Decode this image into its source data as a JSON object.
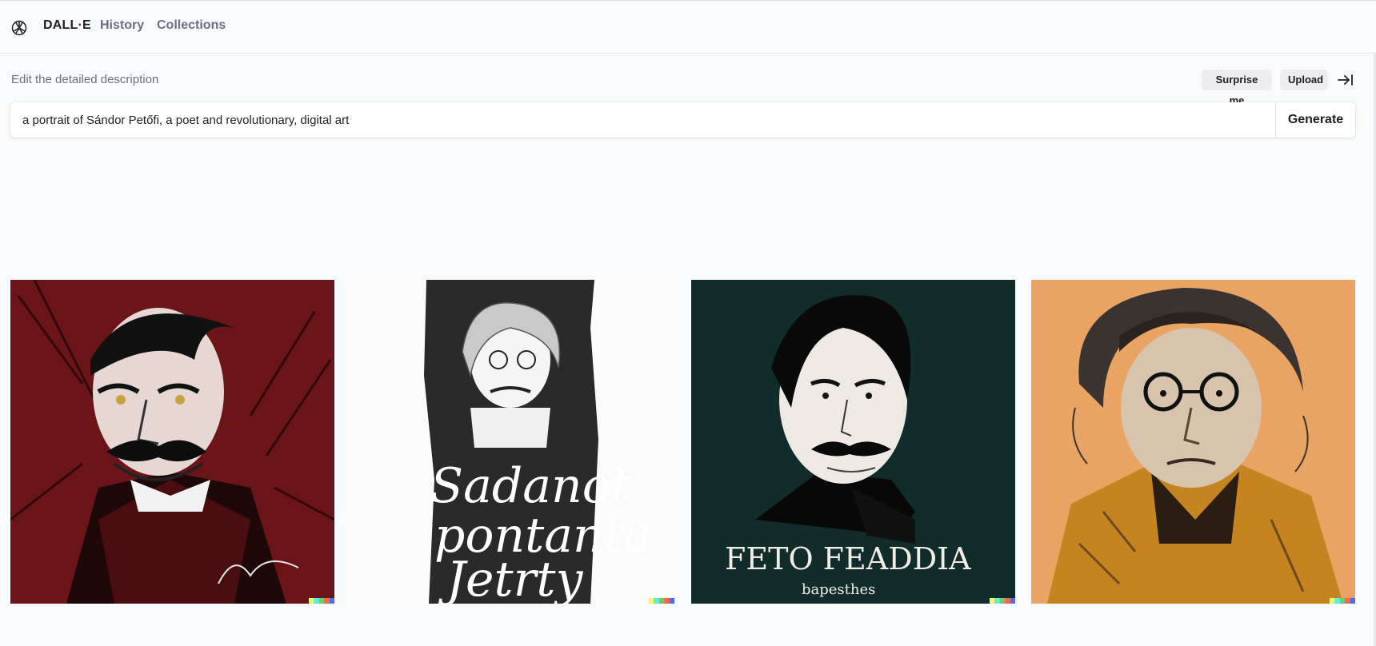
{
  "header": {
    "brand": "DALL·E",
    "nav": {
      "history": "History",
      "collections": "Collections"
    },
    "logo_icon": "openai-logo-icon"
  },
  "editor": {
    "label": "Edit the detailed description",
    "surprise_label": "Surprise me",
    "upload_label": "Upload",
    "collapse_icon": "arrow-right-to-bar-icon",
    "prompt_value": "a portrait of Sándor Petőfi, a poet and revolutionary, digital art",
    "generate_label": "Generate"
  },
  "results": {
    "images": [
      {
        "style": "red expressive ink portrait",
        "bg": "#6b1518"
      },
      {
        "style": "black and white banner with handwritten lettering",
        "bg": "#2a2a2a",
        "lettering": [
          "Sadanot",
          "pontanta",
          "Jetrty"
        ]
      },
      {
        "style": "dark green poster portrait",
        "bg": "#102d2b",
        "lettering": [
          "FETO  FEADDIA",
          "bapesthes"
        ]
      },
      {
        "style": "orange sketch portrait with glasses",
        "bg": "#e9a463"
      }
    ],
    "signature_colors": [
      "#f7f36c",
      "#5ff0d3",
      "#6ccc6c",
      "#f7674d",
      "#4b6ef0"
    ]
  }
}
